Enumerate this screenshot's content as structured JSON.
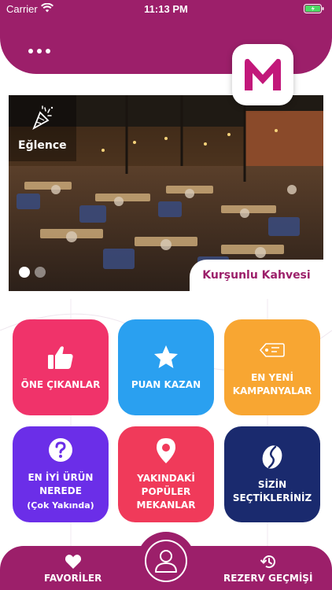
{
  "status_bar": {
    "carrier": "Carrier",
    "time": "11:13 PM"
  },
  "app": {
    "logo_letter": "M",
    "brand_color": "#9c1f6a"
  },
  "banner": {
    "category": "Eğlence",
    "venue_name": "Kurşunlu Kahvesi",
    "slide_count": 2,
    "active_slide": 1
  },
  "tiles": [
    {
      "id": "highlights",
      "label": "ÖNE ÇIKANLAR",
      "color": "#f0336a",
      "icon": "thumbs-up-icon"
    },
    {
      "id": "earn-points",
      "label": "PUAN KAZAN",
      "color": "#2aa0f0",
      "icon": "star-icon"
    },
    {
      "id": "new-campaigns",
      "label_line1": "EN YENİ",
      "label_line2": "KAMPANYALAR",
      "color": "#f8a632",
      "icon": "tag-icon"
    },
    {
      "id": "best-product",
      "label_line1": "EN İYİ ÜRÜN",
      "label_line2": "NEREDE",
      "sub": "(Çok Yakında)",
      "color": "#6b2ee8",
      "icon": "question-icon"
    },
    {
      "id": "nearby-popular",
      "label_line1": "YAKINDAKİ",
      "label_line2": "POPÜLER",
      "label_line3": "MEKANLAR",
      "color": "#f03a5a",
      "icon": "location-pin-icon"
    },
    {
      "id": "your-picks",
      "label_line1": "SİZİN",
      "label_line2": "SEÇTİKLERİNİZ",
      "color": "#1a2a6e",
      "icon": "coffee-bean-icon"
    }
  ],
  "bottom_nav": {
    "favorites": "FAVORİLER",
    "history": "REZERV GEÇMİŞİ"
  }
}
